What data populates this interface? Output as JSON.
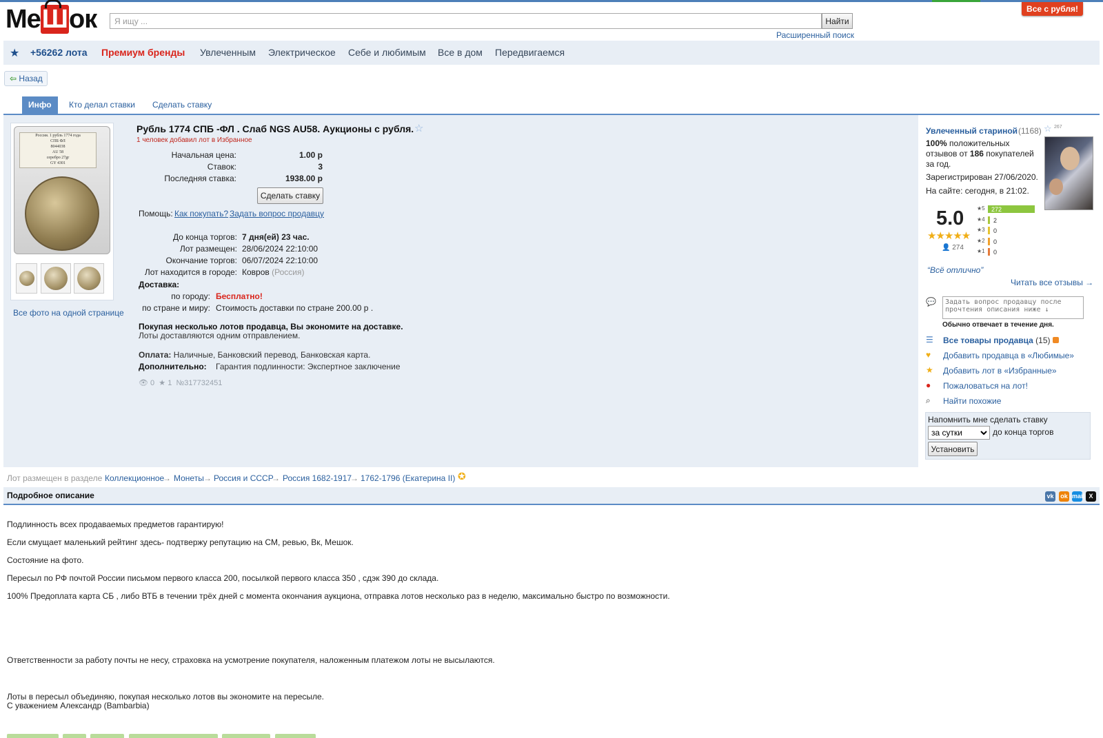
{
  "header": {
    "logo_text": "МеШок",
    "search_placeholder": "Я ищу ...",
    "search_button": "Найти",
    "advanced_search": "Расширенный поиск",
    "promo_button": "Все с рубля!"
  },
  "nav": {
    "lots_count": "+56262 лота",
    "items": [
      "Премиум бренды",
      "Увлеченным",
      "Электрическое",
      "Себе и любимым",
      "Все в дом",
      "Передвигаемся"
    ]
  },
  "back_label": "Назад",
  "tabs": [
    "Инфо",
    "Кто делал ставки",
    "Сделать ставку"
  ],
  "lot": {
    "title": "Рубль 1774 СПБ -ФЛ . Слаб NGS AU58. Аукционы с рубля.",
    "fav_note": "1 человек добавил лот в Избранное",
    "slab_label": [
      "Россия. 1 рубль 1774 года",
      "СПБ ФЛ",
      "8044038",
      "AU 58",
      "серебро 27gr",
      "GY 4301"
    ],
    "start_price_label": "Начальная цена:",
    "start_price": "1.00 р",
    "bids_label": "Ставок:",
    "bids": "3",
    "last_bid_label": "Последняя ставка:",
    "last_bid": "1938.00 р",
    "bid_button": "Сделать ставку",
    "help_label": "Помощь:",
    "help_how": "Как покупать?",
    "help_ask": "Задать вопрос продавцу",
    "end_label": "До конца торгов:",
    "end_value": "7 дня(ей) 23 час.",
    "placed_label": "Лот размещен:",
    "placed_value": "28/06/2024 22:10:00",
    "ends_label": "Окончание торгов:",
    "ends_value": "06/07/2024 22:10:00",
    "city_label": "Лот находится в городе:",
    "city_value": "Ковров",
    "city_country": "(Россия)",
    "delivery_title": "Доставка:",
    "city_delivery_label": "по городу:",
    "city_delivery_value": "Бесплатно!",
    "country_delivery_label": "по стране и миру:",
    "country_delivery_value": "Стоимость доставки по стране 200.00 р .",
    "savings_bold": "Покупая несколько лотов продавца, Вы экономите на доставке.",
    "savings_note": "Лоты доставляются одним отправлением.",
    "payment_label": "Оплата:",
    "payment_value": "Наличные, Банковский перевод, Банковская карта.",
    "extra_label": "Дополнительно:",
    "extra_value": "Гарантия подлинности: Экспертное заключение",
    "views": "0",
    "stars": "1",
    "lot_number": "№317732451",
    "all_photos": "Все фото на одной странице"
  },
  "seller": {
    "name": "Увлеченный стариной",
    "count": "(1168)",
    "star_count": "267",
    "positive_pct": "100%",
    "positive_text": "положительных",
    "reviews_from": "отзывов от",
    "buyers_count": "186",
    "buyers_text": "покупателей",
    "period": "за год.",
    "registered": "Зарегистрирован 27/06/2020.",
    "online": "На сайте: сегодня, в 21:02.",
    "rating": "5.0",
    "stars_display": "★★★★★",
    "people": "274",
    "breakdown": [
      {
        "stars": "★5",
        "count": "272",
        "fraction": 0.993,
        "color": "#8dc63f"
      },
      {
        "stars": "★4",
        "count": "2",
        "fraction": 0.007,
        "color": "#a9c73c"
      },
      {
        "stars": "★3",
        "count": "0",
        "fraction": 0,
        "color": "#e5c431"
      },
      {
        "stars": "★2",
        "count": "0",
        "fraction": 0,
        "color": "#f0a12c"
      },
      {
        "stars": "★1",
        "count": "0",
        "fraction": 0,
        "color": "#e57c3b"
      }
    ],
    "quote": "“Всё отлично”",
    "read_all": "Читать все отзывы →",
    "ask_placeholder": "Задать вопрос продавцу после прочтения описания ниже ↓",
    "answer_note": "Обычно отвечает в течение дня.",
    "links": {
      "all_items": "Все товары продавца",
      "all_items_count": "(15)",
      "add_fav_seller": "Добавить продавца в «Любимые»",
      "add_fav_lot": "Добавить лот в «Избранные»",
      "complain": "Пожаловаться на лот!",
      "find_similar": "Найти похожие"
    },
    "remind_text": "Напомнить мне сделать ставку",
    "remind_option": "за сутки",
    "remind_suffix": "до конца торгов",
    "remind_button": "Установить"
  },
  "breadcrumb": {
    "prefix": "Лот размещен в разделе",
    "items": [
      "Коллекционное",
      "Монеты",
      "Россия и СССР",
      "Россия 1682-1917",
      "1762-1796 (Екатерина II)"
    ],
    "sep": "→"
  },
  "description": {
    "title": "Подробное описание",
    "lines": [
      "Подлинность всех продаваемых предметов гарантирую!",
      "Если смущает маленький рейтинг здесь- подтвержу репутацию на СМ, ревью, Вк, Мешок.",
      "Состояние на фото.",
      "Пересыл по РФ почтой России письмом первого класса 200, посылкой первого класса 350 , сдэк 390 до склада.",
      "100% Предоплата карта СБ , либо ВТБ в течении трёх дней с момента окончания аукциона, отправка лотов несколько раз в неделю, максимально быстро по возможности.",
      "Ответственности за работу почты не несу, страховка на усмотрение покупателя, наложенным платежом лоты не высылаются.",
      "Лоты в пересыл объединяю, покупая несколько лотов вы экономите на пересыле.",
      "С уважением Александр (Bambarbia)"
    ]
  },
  "share": [
    {
      "label": "vk",
      "color": "#4a76a8"
    },
    {
      "label": "ok",
      "color": "#ee8208"
    },
    {
      "label": "mail",
      "color": "#168de2"
    },
    {
      "label": "X",
      "color": "#111111"
    }
  ]
}
